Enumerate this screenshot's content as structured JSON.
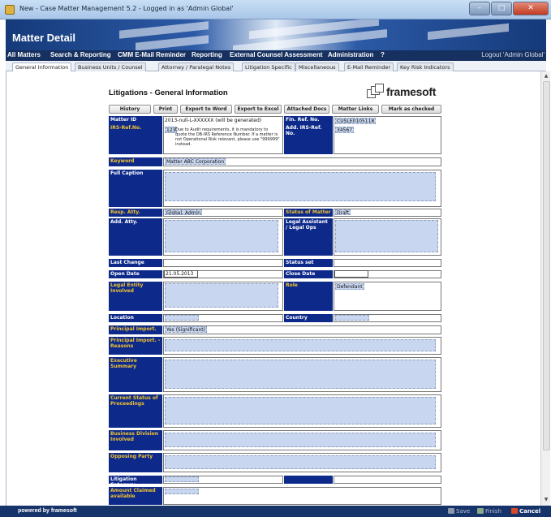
{
  "window": {
    "title": "New - Case Matter Management 5.2 - Logged in as 'Admin Global'",
    "minimize": "–",
    "maximize": "□",
    "close": "✕"
  },
  "header": {
    "heading": "Matter Detail"
  },
  "menu": {
    "items": [
      "All Matters",
      "Search & Reporting",
      "CMM E-Mail Reminder",
      "Reporting",
      "External Counsel Assessment",
      "Administration",
      "?"
    ],
    "logout": "Logout 'Admin Global'"
  },
  "tabs": [
    "General Information",
    "Business Units / Counsel",
    "Attorney / Paralegal Notes",
    "Litigation Specific",
    "Miscellaneous",
    "E-Mail Reminder",
    "Key Risk Indicators"
  ],
  "page": {
    "title": "Litigations - General Information",
    "logo": "framesoft"
  },
  "actions": [
    "History",
    "Print",
    "Export to Word",
    "Export to Excel",
    "Attached Docs",
    "Matter Links",
    "Mark as checked"
  ],
  "form": {
    "matter_id_label": "Matter ID",
    "matter_id_value": "2013-null-L-XXXXXX (will be generated)",
    "fin_ref_label": "Fin. Ref. No.",
    "fin_ref_value": "CUSLE0105118",
    "irs_ref_label": "IRS-Ref.No.",
    "irs_ref_value": "123",
    "irs_note": "Due to Audit requirements, it is mandatory to quote the DB-IRS Reference Number. If a matter is not Operational Risk relevant, please use \"999999\" instead.",
    "add_irs_label": "Add. IRS-Ref. No.",
    "add_irs_value": "34567",
    "keyword_label": "Keyword",
    "keyword_value": "Matter ABC Corporation",
    "full_caption_label": "Full Caption",
    "resp_atty_label": "Resp. Atty.",
    "resp_atty_value": "Global, Admin",
    "status_label": "Status of Matter",
    "status_value": "Draft",
    "add_atty_label": "Add. Atty.",
    "legal_assistant_label": "Legal Assistant / Legal Ops",
    "last_change_label": "Last Change",
    "status_set_label": "Status set",
    "open_date_label": "Open Date",
    "open_date_value": "21.05.2013",
    "close_date_label": "Close Date",
    "legal_entity_label": "Legal Entity Involved",
    "role_label": "Role",
    "role_value": "Defendant",
    "location_label": "Location",
    "country_label": "Country",
    "principal_import_label": "Principal Import.",
    "principal_import_value": "Yes (Significant)",
    "principal_reasons_label": "Principal Import. - Reasons",
    "exec_summary_label": "Executive Summary",
    "current_status_label": "Current Status of Proceedings",
    "business_division_label": "Business Division Involved",
    "opposing_party_label": "Opposing Party",
    "litigation_category_label": "Litigation Category",
    "amount_claimed_label": "Amount Claimed available"
  },
  "footer": {
    "powered": "powered by framesoft",
    "save": "Save",
    "finish": "Finish",
    "cancel": "Cancel"
  },
  "colors": {
    "label_bg": "#0d2a8a",
    "label_gold": "#f1c232",
    "input_bg": "#c8d6ef",
    "menu_bg": "#16305f"
  }
}
